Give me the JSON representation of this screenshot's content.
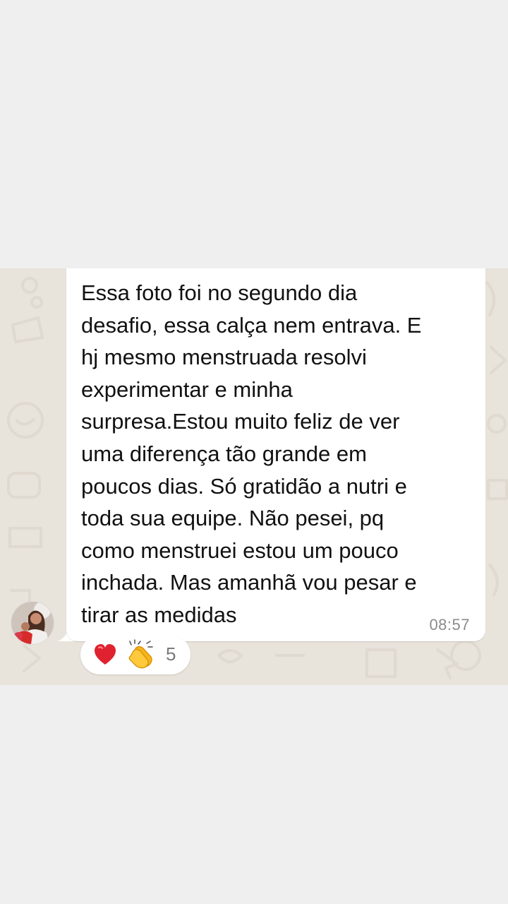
{
  "message": {
    "text": "Essa foto foi no segundo dia\ndesafio, essa calça nem entrava. E\nhj mesmo menstruada resolvi\nexperimentar e minha\nsurpresa.Estou muito feliz de ver\numa diferença tão grande em\npoucos dias. Só gratidão a nutri e\ntoda sua equipe. Não pesei, pq\ncomo menstruei estou um pouco\ninchada. Mas amanhã vou pesar e\ntirar as medidas",
    "time": "08:57"
  },
  "reactions": {
    "emojis": [
      "heart-icon",
      "clapping-hands-icon"
    ],
    "count": "5"
  },
  "colors": {
    "page_background": "#efefef",
    "chat_background": "#e8e3db",
    "bubble_background": "#ffffff",
    "heart": "#e0222f",
    "clap": "#f5b51a"
  }
}
